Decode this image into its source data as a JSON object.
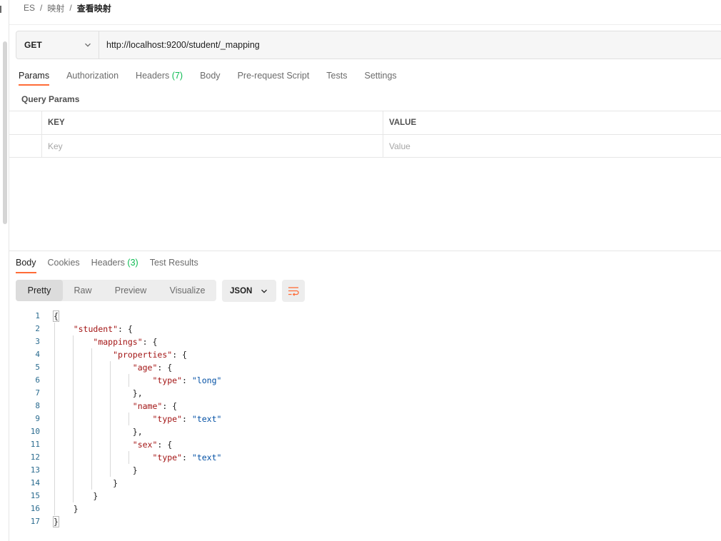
{
  "breadcrumb": {
    "root": "ES",
    "folder": "映射",
    "current": "查看映射"
  },
  "request": {
    "method": "GET",
    "url": "http://localhost:9200/student/_mapping"
  },
  "request_tabs": [
    {
      "label": "Params",
      "count": ""
    },
    {
      "label": "Authorization",
      "count": ""
    },
    {
      "label": "Headers",
      "count": "(7)"
    },
    {
      "label": "Body",
      "count": ""
    },
    {
      "label": "Pre-request Script",
      "count": ""
    },
    {
      "label": "Tests",
      "count": ""
    },
    {
      "label": "Settings",
      "count": ""
    }
  ],
  "query_params": {
    "title": "Query Params",
    "col_key": "KEY",
    "col_value": "VALUE",
    "key_placeholder": "Key",
    "value_placeholder": "Value"
  },
  "response_tabs": [
    {
      "label": "Body",
      "count": ""
    },
    {
      "label": "Cookies",
      "count": ""
    },
    {
      "label": "Headers",
      "count": "(3)"
    },
    {
      "label": "Test Results",
      "count": ""
    }
  ],
  "view_modes": [
    "Pretty",
    "Raw",
    "Preview",
    "Visualize"
  ],
  "format": "JSON",
  "icons": {
    "method_chevron": "chevron-down-icon",
    "format_chevron": "chevron-down-icon",
    "wrap": "wrap-lines-icon"
  },
  "colors": {
    "accent": "#ff6c37",
    "count": "#0cbb52",
    "json_key": "#a31515",
    "json_string": "#0451a5"
  },
  "code_lines": [
    "1",
    "2",
    "3",
    "4",
    "5",
    "6",
    "7",
    "8",
    "9",
    "10",
    "11",
    "12",
    "13",
    "14",
    "15",
    "16",
    "17"
  ],
  "json": {
    "k_student": "\"student\"",
    "k_mappings": "\"mappings\"",
    "k_properties": "\"properties\"",
    "k_age": "\"age\"",
    "k_name": "\"name\"",
    "k_sex": "\"sex\"",
    "k_type": "\"type\"",
    "v_long": "\"long\"",
    "v_text": "\"text\""
  }
}
